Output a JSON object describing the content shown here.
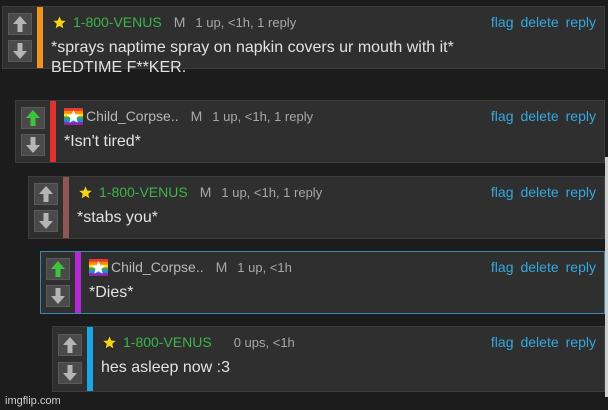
{
  "comments": [
    {
      "user": "1-800-VENUS",
      "user_color": "#3cb54a",
      "badge": "star-icon",
      "mod": "M",
      "meta": "1 up, <1h, 1 reply",
      "text": "*sprays naptime spray on napkin covers ur mouth with it*\nBEDTIME F**KER.",
      "bar_color": "#f0931f",
      "upvoted": false
    },
    {
      "user": "Child_Corpse..",
      "user_color": "#b8b8b8",
      "badge": "rainbow-star-icon",
      "mod": "M",
      "meta": "1 up, <1h, 1 reply",
      "text": "*Isn't tired*",
      "bar_color": "#e0322e",
      "upvoted": true
    },
    {
      "user": "1-800-VENUS",
      "user_color": "#3cb54a",
      "badge": "star-icon",
      "mod": "M",
      "meta": "1 up, <1h, 1 reply",
      "text": "*stabs you*",
      "bar_color": "#8f5656",
      "upvoted": false
    },
    {
      "user": "Child_Corpse..",
      "user_color": "#b8b8b8",
      "badge": "rainbow-star-icon",
      "mod": "M",
      "meta": "1 up, <1h",
      "text": "*Dies*",
      "bar_color": "#b12ad6",
      "upvoted": true
    },
    {
      "user": "1-800-VENUS",
      "user_color": "#3cb54a",
      "badge": "star-icon",
      "mod": "",
      "meta": "0 ups, <1h",
      "text": "hes asleep now :3",
      "bar_color": "#1ba7e3",
      "upvoted": false
    }
  ],
  "actions": {
    "flag": "flag",
    "delete": "delete",
    "reply": "reply"
  },
  "watermark": "imgflip.com"
}
